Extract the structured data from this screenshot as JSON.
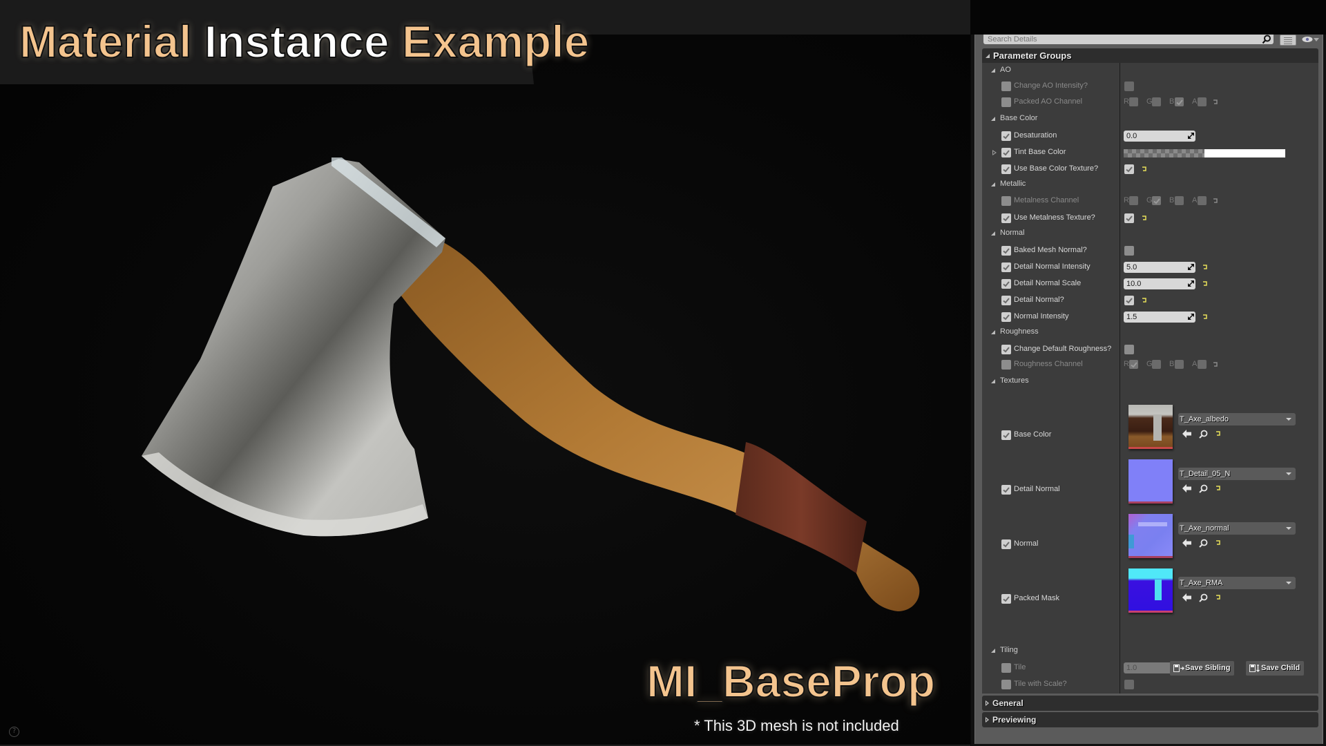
{
  "overlay": {
    "title_words": [
      {
        "text": "Material",
        "color": "orange"
      },
      {
        "text": "Instance",
        "color": "white"
      },
      {
        "text": "Example",
        "color": "orange"
      }
    ],
    "material_name": "MI_BaseProp",
    "mesh_note": "* This 3D mesh is not included",
    "help_icon": "?"
  },
  "colors": {
    "title_orange": "#f4c48e",
    "reset_yellow": "#e8e05a",
    "panel_bg": "#3c3c3c",
    "header_bg": "#2d2d2d"
  },
  "details": {
    "search_placeholder": "Search Details",
    "search_icon": "search-icon",
    "view_options_icon": "view-options-icon",
    "visibility_icon": "eye-icon",
    "parameter_groups_label": "Parameter Groups",
    "groups": [
      {
        "name": "AO",
        "params": [
          {
            "label": "Change AO Intensity?",
            "enabled": false,
            "type": "bool",
            "value": false
          },
          {
            "label": "Packed AO Channel",
            "enabled": false,
            "type": "channels",
            "channels": {
              "R": false,
              "G": false,
              "B": true,
              "A": false
            }
          }
        ]
      },
      {
        "name": "Base Color",
        "params": [
          {
            "label": "Desaturation",
            "enabled": true,
            "type": "scalar",
            "value": "0.0"
          },
          {
            "label": "Tint Base Color",
            "enabled": true,
            "type": "color",
            "value": "#ffffff",
            "expandable": true
          },
          {
            "label": "Use Base Color Texture?",
            "enabled": true,
            "type": "bool",
            "value": true
          }
        ]
      },
      {
        "name": "Metallic",
        "params": [
          {
            "label": "Metalness Channel",
            "enabled": false,
            "type": "channels",
            "channels": {
              "R": false,
              "G": true,
              "B": false,
              "A": false
            }
          },
          {
            "label": "Use Metalness Texture?",
            "enabled": true,
            "type": "bool",
            "value": true
          }
        ]
      },
      {
        "name": "Normal",
        "params": [
          {
            "label": "Baked Mesh Normal?",
            "enabled": true,
            "type": "bool",
            "value": false
          },
          {
            "label": "Detail Normal Intensity",
            "enabled": true,
            "type": "scalar",
            "value": "5.0"
          },
          {
            "label": "Detail Normal Scale",
            "enabled": true,
            "type": "scalar",
            "value": "10.0"
          },
          {
            "label": "Detail Normal?",
            "enabled": true,
            "type": "bool",
            "value": true
          },
          {
            "label": "Normal Intensity",
            "enabled": true,
            "type": "scalar",
            "value": "1.5"
          }
        ]
      },
      {
        "name": "Roughness",
        "params": [
          {
            "label": "Change Default Roughness?",
            "enabled": true,
            "type": "bool",
            "value": false
          },
          {
            "label": "Roughness Channel",
            "enabled": false,
            "type": "channels",
            "channels": {
              "R": true,
              "G": false,
              "B": false,
              "A": false
            }
          }
        ]
      },
      {
        "name": "Textures",
        "params": [
          {
            "label": "Base Color",
            "enabled": true,
            "type": "texture",
            "value": "T_Axe_albedo"
          },
          {
            "label": "Detail Normal",
            "enabled": true,
            "type": "texture",
            "value": "T_Detail_05_N"
          },
          {
            "label": "Normal",
            "enabled": true,
            "type": "texture",
            "value": "T_Axe_normal"
          },
          {
            "label": "Packed Mask",
            "enabled": true,
            "type": "texture",
            "value": "T_Axe_RMA"
          }
        ]
      },
      {
        "name": "Tiling",
        "params": [
          {
            "label": "Tile",
            "enabled": false,
            "type": "scalar",
            "value": "1.0"
          },
          {
            "label": "Tile with Scale?",
            "enabled": false,
            "type": "bool",
            "value": false
          }
        ]
      }
    ],
    "buttons": {
      "save_sibling": "Save Sibling",
      "save_child": "Save Child"
    },
    "categories": [
      "General",
      "Previewing"
    ]
  }
}
